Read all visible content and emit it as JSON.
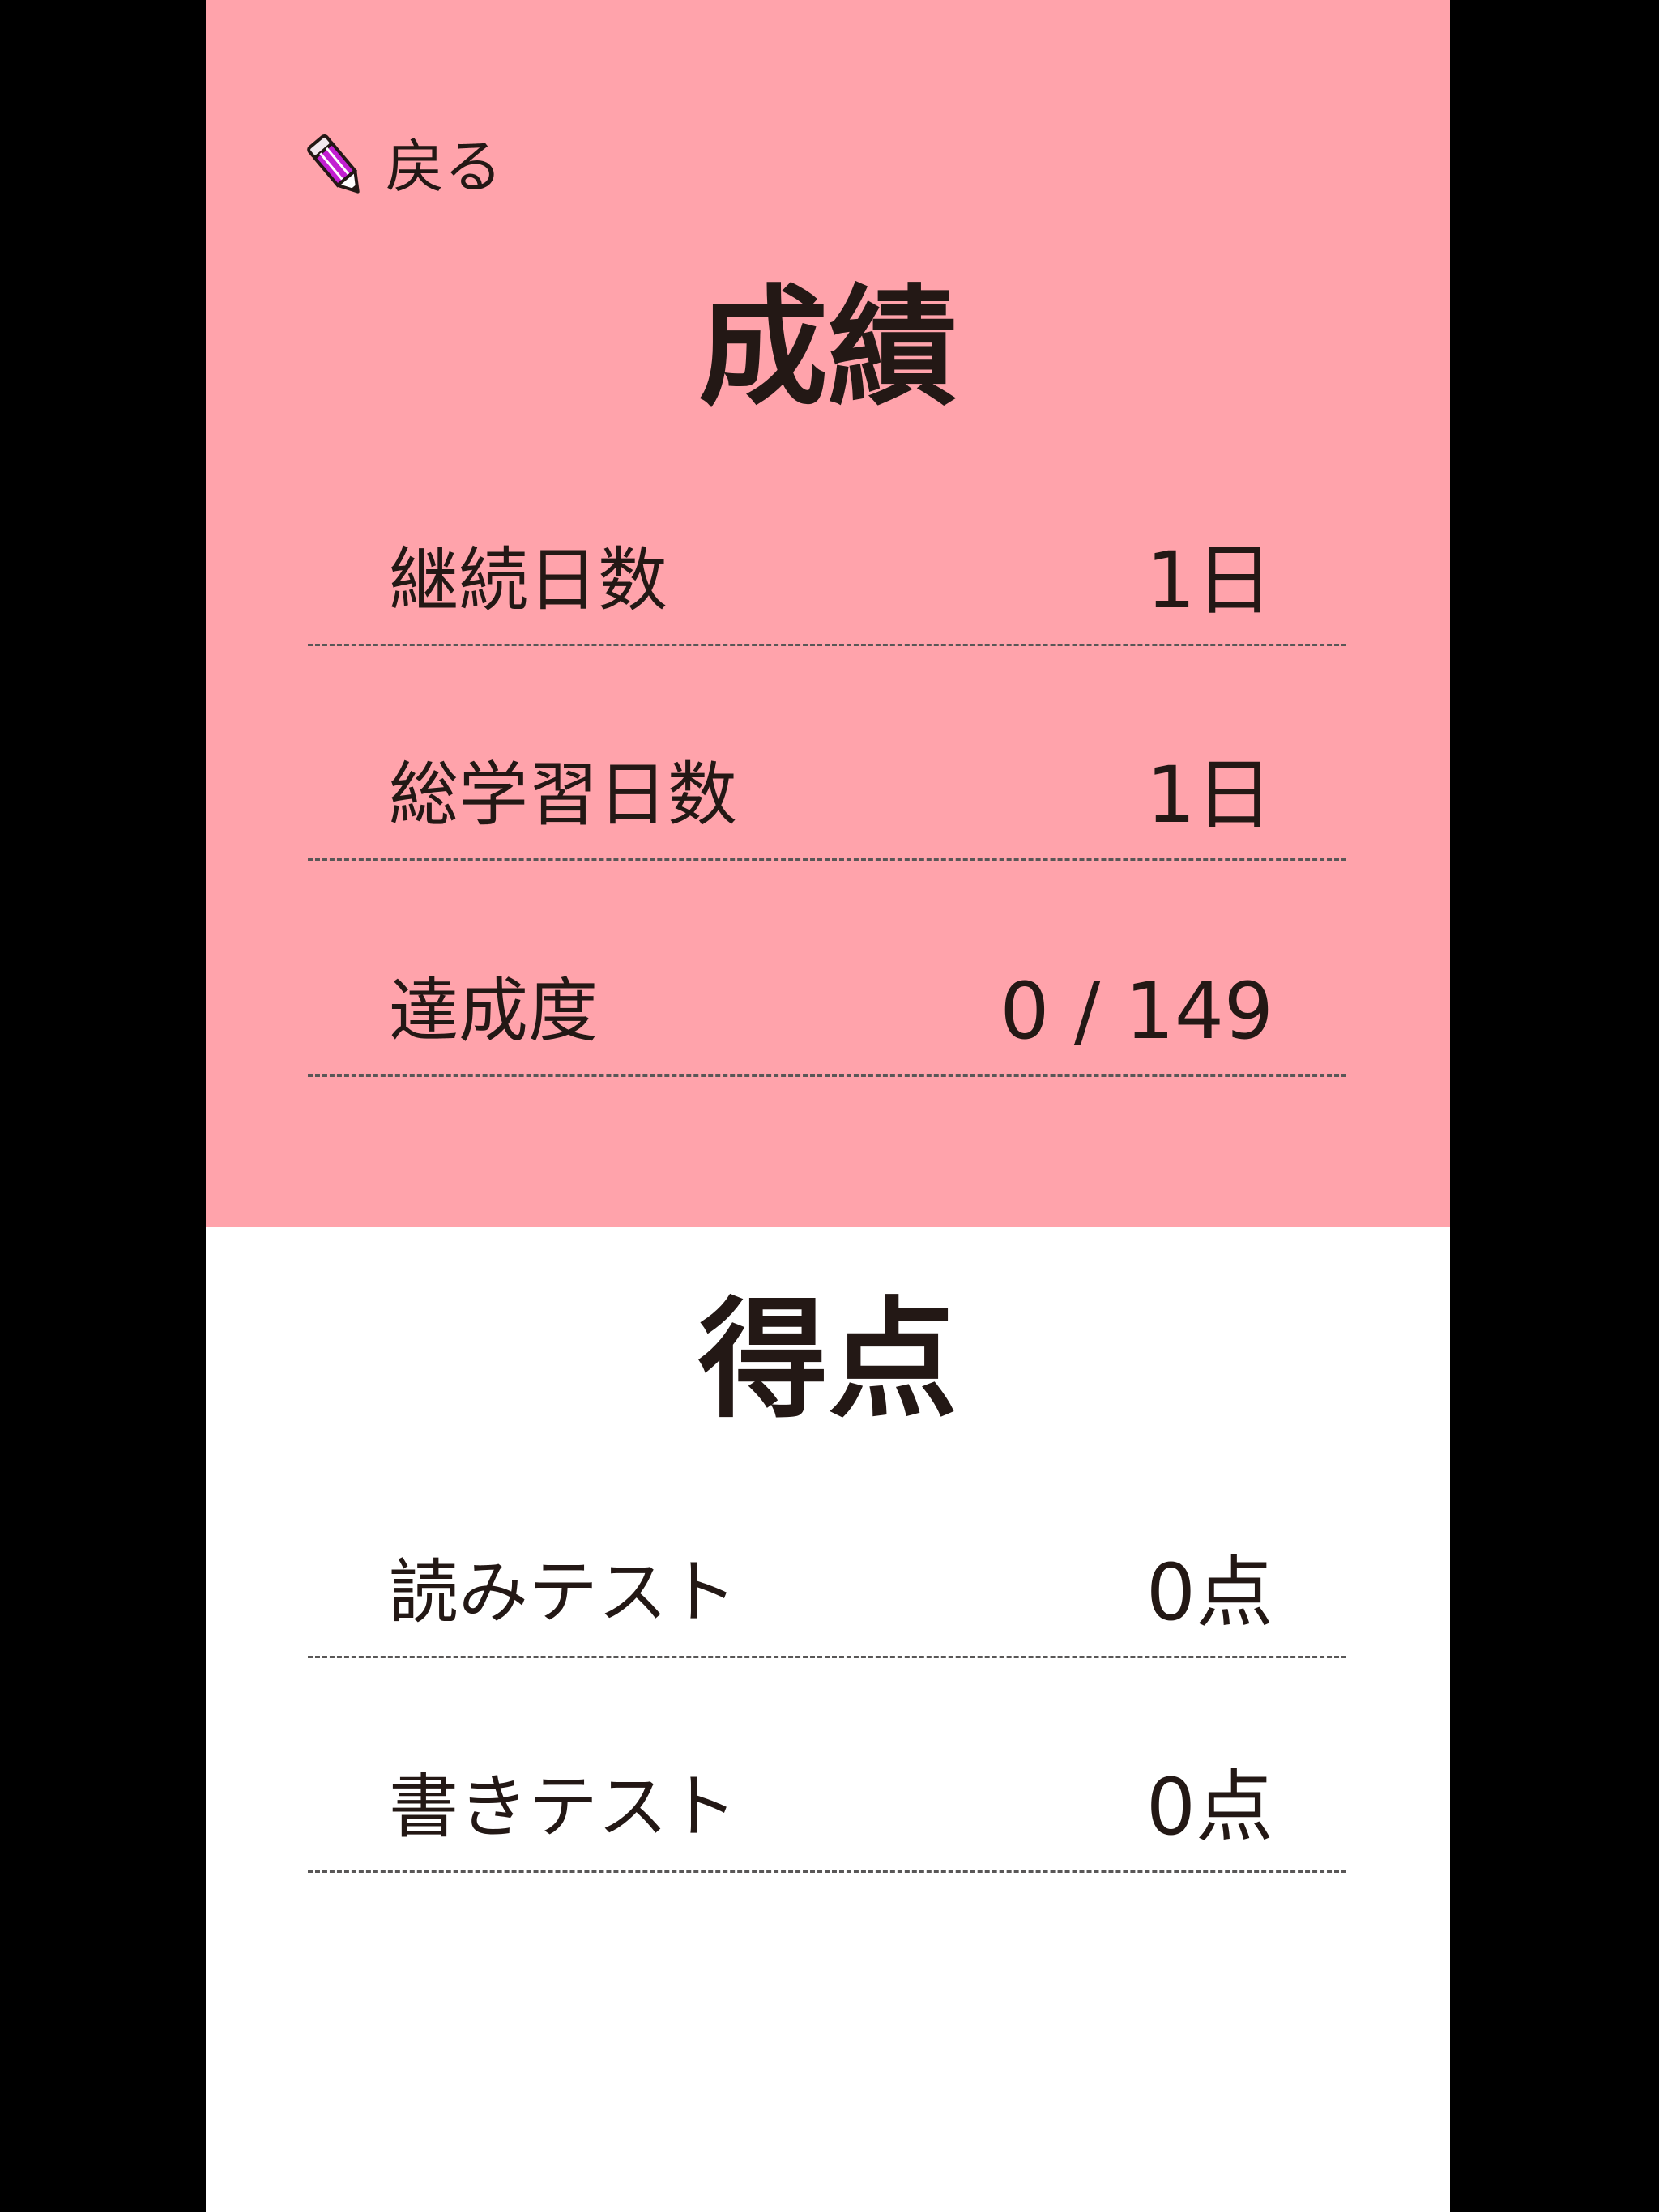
{
  "back": {
    "label": "戻る",
    "icon": "pencil-icon"
  },
  "performance": {
    "title": "成績",
    "rows": [
      {
        "label": "継続日数",
        "value": "1日"
      },
      {
        "label": "総学習日数",
        "value": "1日"
      },
      {
        "label": "達成度",
        "value": "0 / 149"
      }
    ]
  },
  "scores": {
    "title": "得点",
    "rows": [
      {
        "label": "読みテスト",
        "value": "0点"
      },
      {
        "label": "書きテスト",
        "value": "0点"
      }
    ]
  },
  "colors": {
    "panel_background": "#ffa3ab",
    "page_background": "#ffffff",
    "text": "#231815",
    "divider": "#595757",
    "pencil_body": "#c21fd1"
  }
}
